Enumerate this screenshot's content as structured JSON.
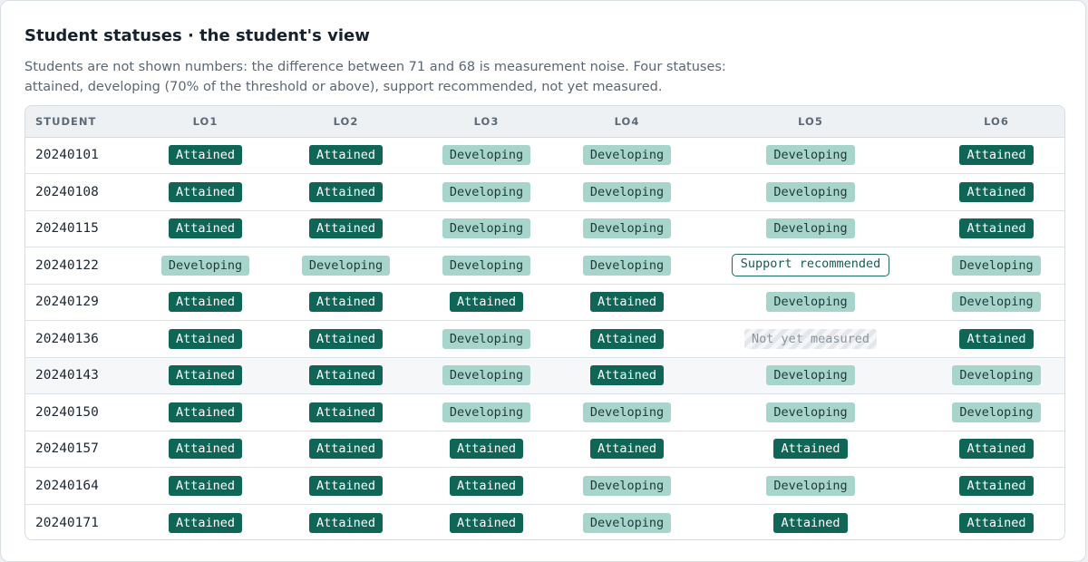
{
  "title": "Student statuses · the student's view",
  "subtitle": "Students are not shown numbers: the difference between 71 and 68 is measurement noise. Four statuses: attained, developing (70% of the threshold or above), support recommended, not yet measured.",
  "columns": [
    "STUDENT",
    "LO1",
    "LO2",
    "LO3",
    "LO4",
    "LO5",
    "LO6"
  ],
  "status_labels": {
    "attained": "Attained",
    "developing": "Developing",
    "support": "Support recommended",
    "notyet": "Not yet measured"
  },
  "colors": {
    "attained_bg": "#0f6656",
    "developing_bg": "#a8d5cb",
    "support_border": "#1d6a5e"
  },
  "rows": [
    {
      "student": "20240101",
      "statuses": [
        "attained",
        "attained",
        "developing",
        "developing",
        "developing",
        "attained"
      ]
    },
    {
      "student": "20240108",
      "statuses": [
        "attained",
        "attained",
        "developing",
        "developing",
        "developing",
        "attained"
      ]
    },
    {
      "student": "20240115",
      "statuses": [
        "attained",
        "attained",
        "developing",
        "developing",
        "developing",
        "attained"
      ]
    },
    {
      "student": "20240122",
      "statuses": [
        "developing",
        "developing",
        "developing",
        "developing",
        "support",
        "developing"
      ]
    },
    {
      "student": "20240129",
      "statuses": [
        "attained",
        "attained",
        "attained",
        "attained",
        "developing",
        "developing"
      ]
    },
    {
      "student": "20240136",
      "statuses": [
        "attained",
        "attained",
        "developing",
        "attained",
        "notyet",
        "attained"
      ]
    },
    {
      "student": "20240143",
      "statuses": [
        "attained",
        "attained",
        "developing",
        "attained",
        "developing",
        "developing"
      ]
    },
    {
      "student": "20240150",
      "statuses": [
        "attained",
        "attained",
        "developing",
        "developing",
        "developing",
        "developing"
      ]
    },
    {
      "student": "20240157",
      "statuses": [
        "attained",
        "attained",
        "attained",
        "attained",
        "attained",
        "attained"
      ]
    },
    {
      "student": "20240164",
      "statuses": [
        "attained",
        "attained",
        "attained",
        "developing",
        "developing",
        "attained"
      ]
    },
    {
      "student": "20240171",
      "statuses": [
        "attained",
        "attained",
        "attained",
        "developing",
        "attained",
        "attained"
      ]
    }
  ]
}
